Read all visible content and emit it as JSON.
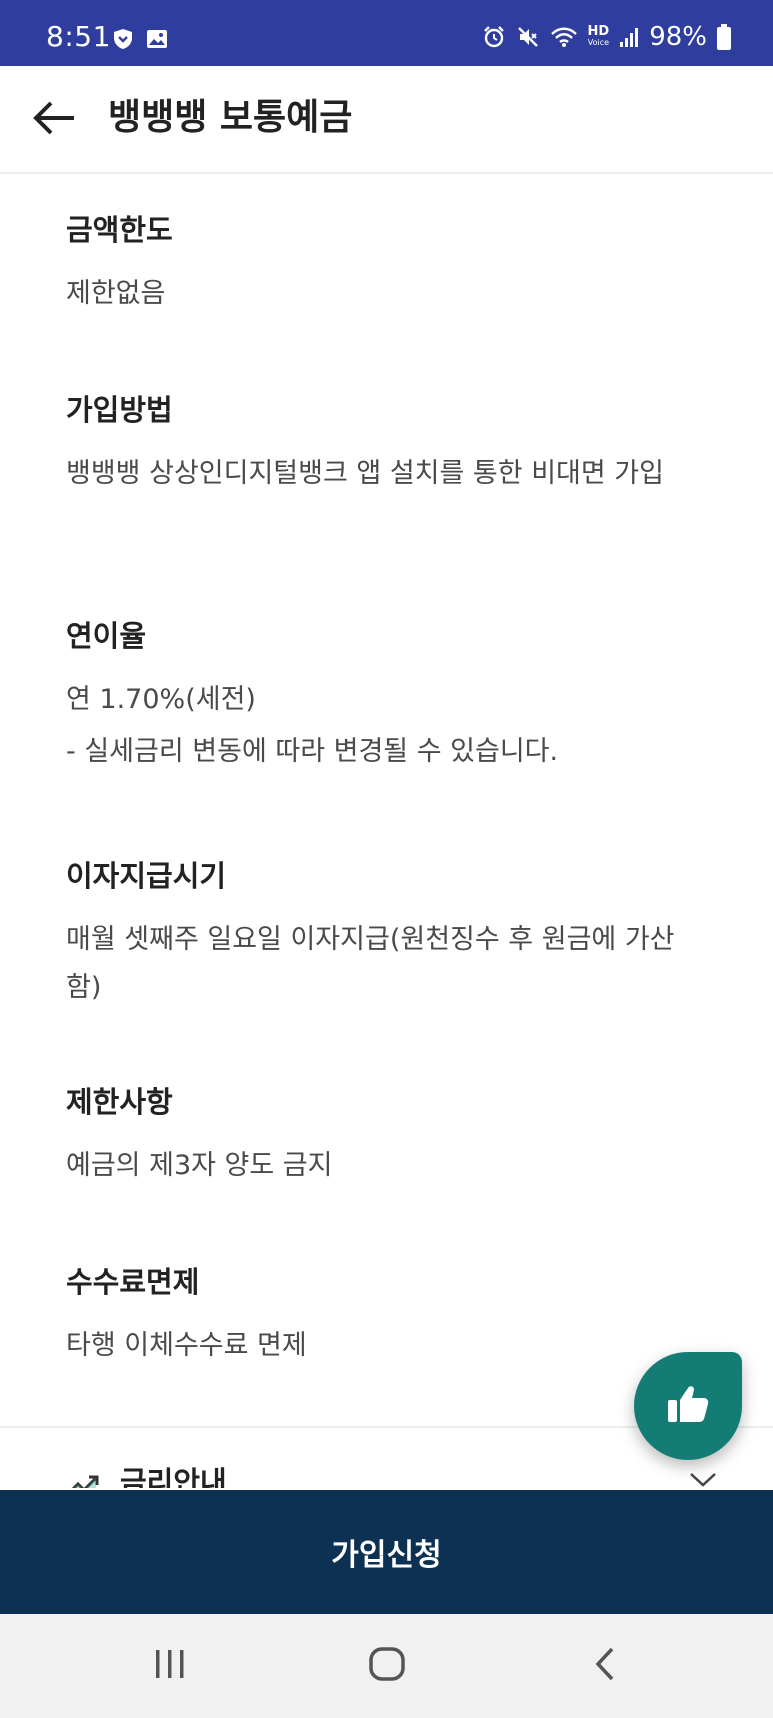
{
  "status_bar": {
    "time": "8:51",
    "battery": "98%",
    "icons": [
      "shield-icon",
      "image-icon",
      "alarm-icon",
      "mute-icon",
      "wifi-icon",
      "hd-voice-icon",
      "signal-icon",
      "battery-icon"
    ],
    "hd_label": "HD",
    "voice_label": "Voice",
    "background_color": "#2f3e9e"
  },
  "header": {
    "title": "뱅뱅뱅 보통예금",
    "back_icon": "arrow-left-icon"
  },
  "sections": [
    {
      "title": "금액한도",
      "body": "제한없음",
      "note": ""
    },
    {
      "title": "가입방법",
      "body": "뱅뱅뱅 상상인디지털뱅크 앱 설치를 통한 비대면 가입",
      "note": ""
    },
    {
      "title": "연이율",
      "body": "연 1.70%(세전)",
      "note": "- 실세금리 변동에 따라 변경될 수 있습니다."
    },
    {
      "title": "이자지급시기",
      "body": "매월 셋째주 일요일 이자지급(원천징수 후 원금에 가산함)",
      "note": ""
    },
    {
      "title": "제한사항",
      "body": "예금의 제3자 양도 금지",
      "note": ""
    },
    {
      "title": "수수료면제",
      "body": "타행 이체수수료 면제",
      "note": ""
    }
  ],
  "rate_info": {
    "label": "금리안내",
    "icon": "trending-up-icon",
    "chevron": "chevron-down-icon"
  },
  "fab": {
    "icon": "thumbs-up-icon",
    "color": "#137d75"
  },
  "apply_button": {
    "label": "가입신청",
    "color": "#0d3152"
  },
  "nav_bar": {
    "icons": [
      "recent-apps-icon",
      "home-icon",
      "back-icon"
    ]
  }
}
